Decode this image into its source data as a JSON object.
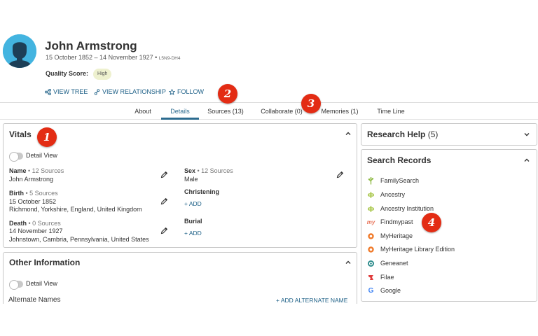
{
  "person": {
    "name": "John Armstrong",
    "dates": "15 October 1852 – 14 November 1927 • ",
    "pid": "L5N9-DH4",
    "quality_label": "Quality Score:",
    "quality_value": "High"
  },
  "actions": {
    "view_tree": "VIEW TREE",
    "view_relationship": "VIEW RELATIONSHIP",
    "follow": "FOLLOW"
  },
  "tabs": [
    {
      "label": "About"
    },
    {
      "label": "Details"
    },
    {
      "label": "Sources (13)"
    },
    {
      "label": "Collaborate (0)"
    },
    {
      "label": "Memories (1)"
    },
    {
      "label": "Time Line"
    }
  ],
  "active_tab": "Details",
  "vitals": {
    "title": "Vitals",
    "detail_view": "Detail View",
    "name": {
      "label": "Name",
      "sources": " • 12 Sources",
      "value": "John Armstrong"
    },
    "birth": {
      "label": "Birth",
      "sources": " • 5 Sources",
      "date": "15 October 1852",
      "place": "Richmond, Yorkshire, England, United Kingdom"
    },
    "death": {
      "label": "Death",
      "sources": " • 0 Sources",
      "date": "14 November 1927",
      "place": "Johnstown, Cambria, Pennsylvania, United States"
    },
    "sex": {
      "label": "Sex",
      "sources": " • 12 Sources",
      "value": "Male"
    },
    "christening": {
      "label": "Christening",
      "add": "+ ADD"
    },
    "burial": {
      "label": "Burial",
      "add": "+ ADD"
    }
  },
  "other_info": {
    "title": "Other Information",
    "detail_view": "Detail View",
    "alternate_names": "Alternate Names",
    "add_alternate_name": "+ ADD ALTERNATE NAME"
  },
  "research_help": {
    "title": "Research Help",
    "count": "(5)"
  },
  "search_records": {
    "title": "Search Records",
    "items": [
      {
        "label": "FamilySearch",
        "icon": "familysearch-tree-icon",
        "color": "#8cb83f"
      },
      {
        "label": "Ancestry",
        "icon": "ancestry-leaf-icon",
        "color": "#9cbe30"
      },
      {
        "label": "Ancestry Institution",
        "icon": "ancestry-leaf-icon",
        "color": "#9cbe30"
      },
      {
        "label": "Findmypast",
        "icon": "findmypast-icon",
        "color": "#e8745a"
      },
      {
        "label": "MyHeritage",
        "icon": "myheritage-icon",
        "color": "#f07a2a"
      },
      {
        "label": "MyHeritage Library Edition",
        "icon": "myheritage-icon",
        "color": "#f07a2a"
      },
      {
        "label": "Geneanet",
        "icon": "geneanet-icon",
        "color": "#2a8a8a"
      },
      {
        "label": "Filae",
        "icon": "filae-icon",
        "color": "#e03c3c"
      },
      {
        "label": "Google",
        "icon": "google-icon",
        "color": "#4285f4"
      }
    ]
  },
  "callouts": [
    "1",
    "2",
    "3",
    "4"
  ],
  "colors": {
    "link": "#1c5f86",
    "active_tab": "#2c6b8f",
    "avatar_bg": "#43b4e0",
    "quality_badge_bg": "#eef1cf",
    "callout": "#e32c14"
  }
}
